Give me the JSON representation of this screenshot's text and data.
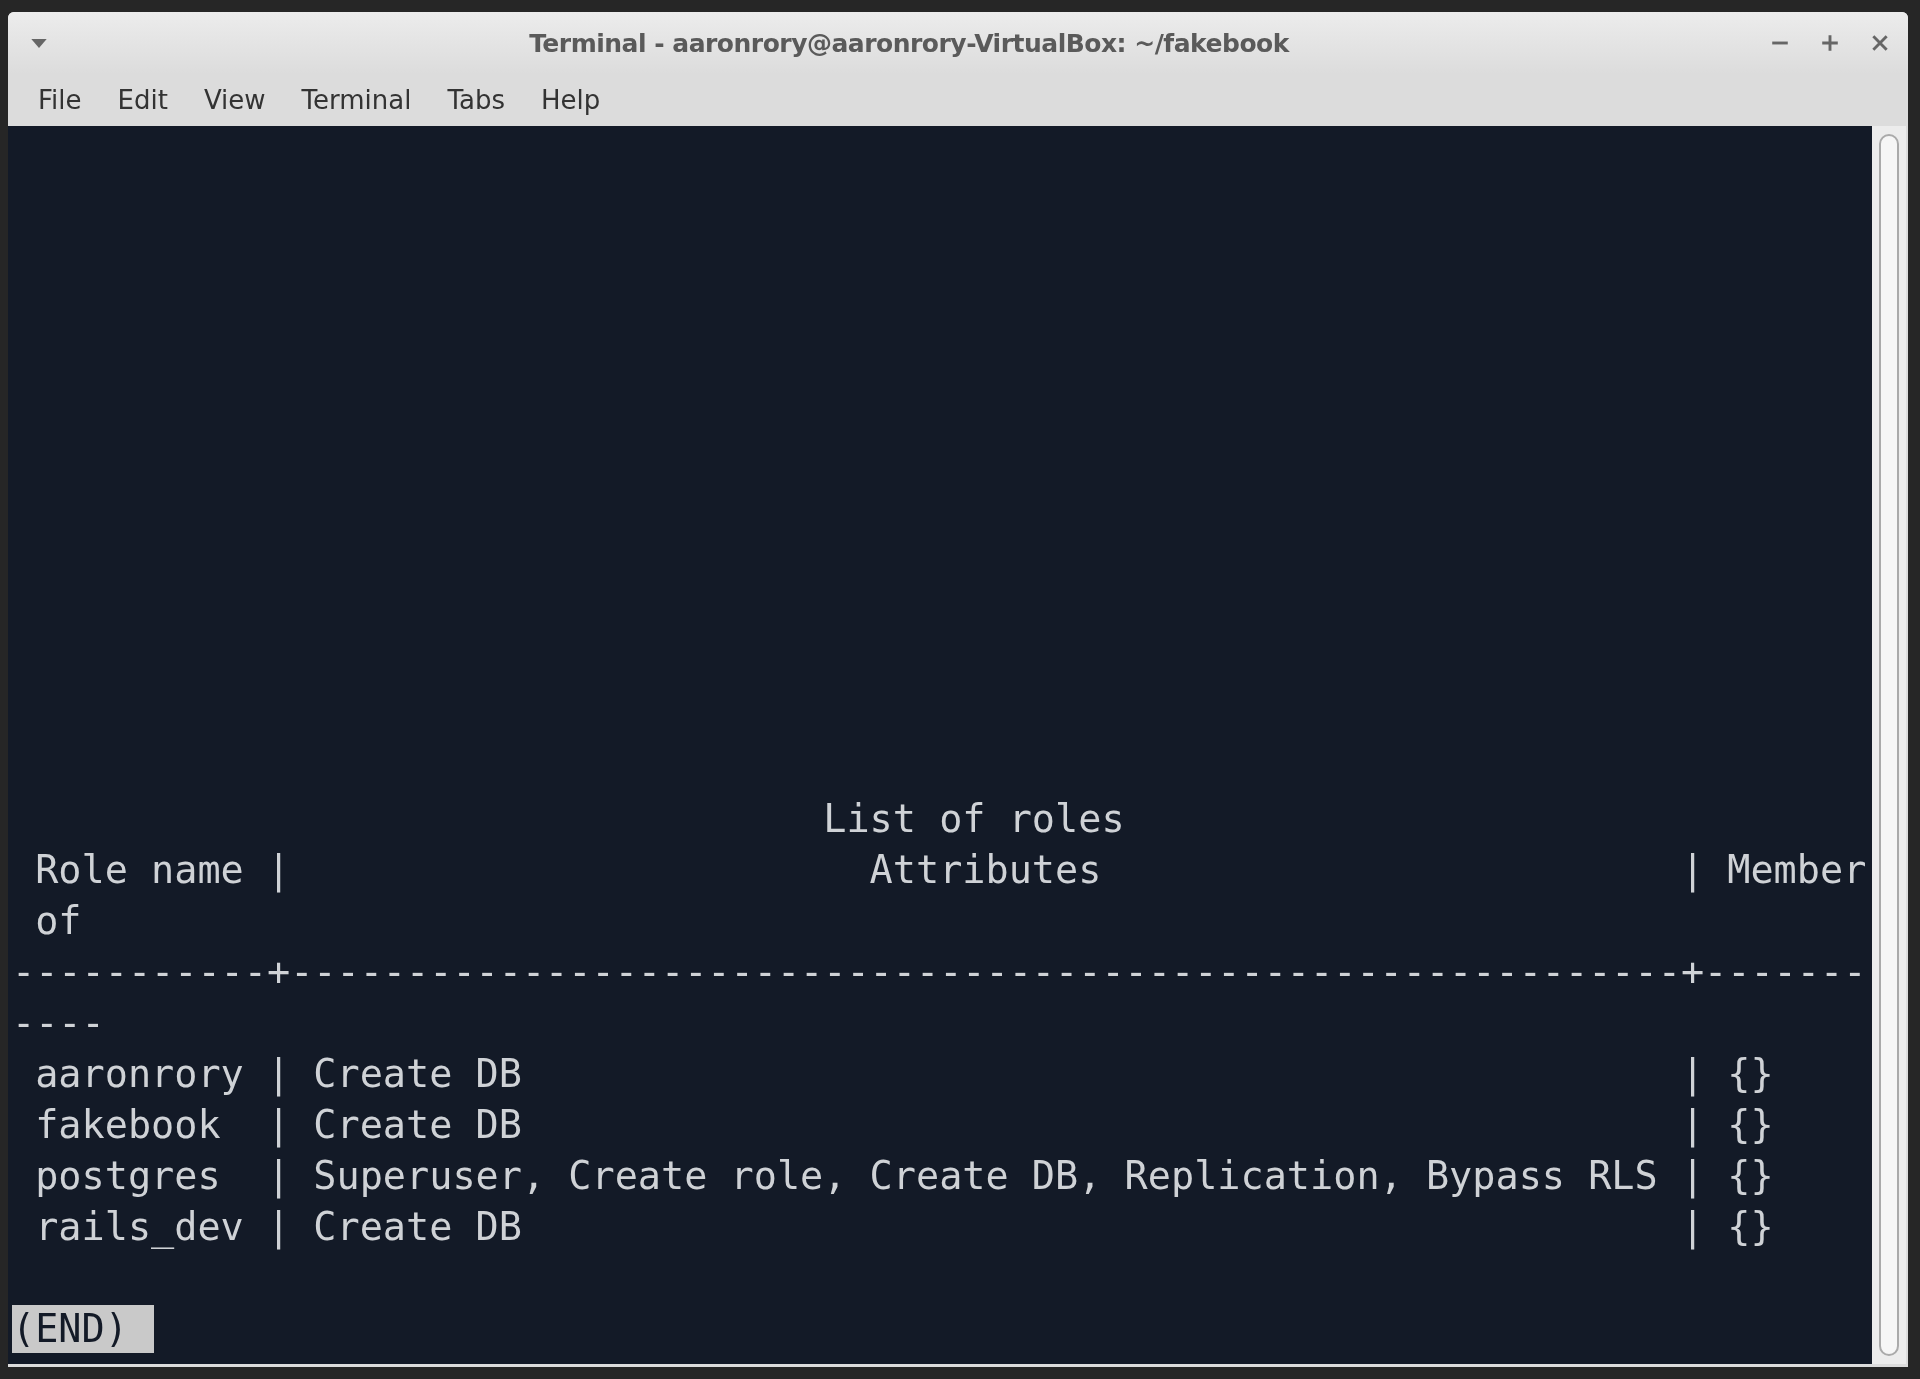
{
  "window": {
    "title": "Terminal - aaronrory@aaronrory-VirtualBox: ~/fakebook"
  },
  "menu": [
    "File",
    "Edit",
    "View",
    "Terminal",
    "Tabs",
    "Help"
  ],
  "terminal": {
    "lines": [
      "                                   List of roles",
      " Role name |                         Attributes                         | Member",
      " of",
      "-----------+------------------------------------------------------------+-------",
      "----",
      " aaronrory | Create DB                                                  | {}",
      " fakebook  | Create DB                                                  | {}",
      " postgres  | Superuser, Create role, Create DB, Replication, Bypass RLS | {}",
      " rails_dev | Create DB                                                  | {}"
    ],
    "prompt": "(END)"
  }
}
